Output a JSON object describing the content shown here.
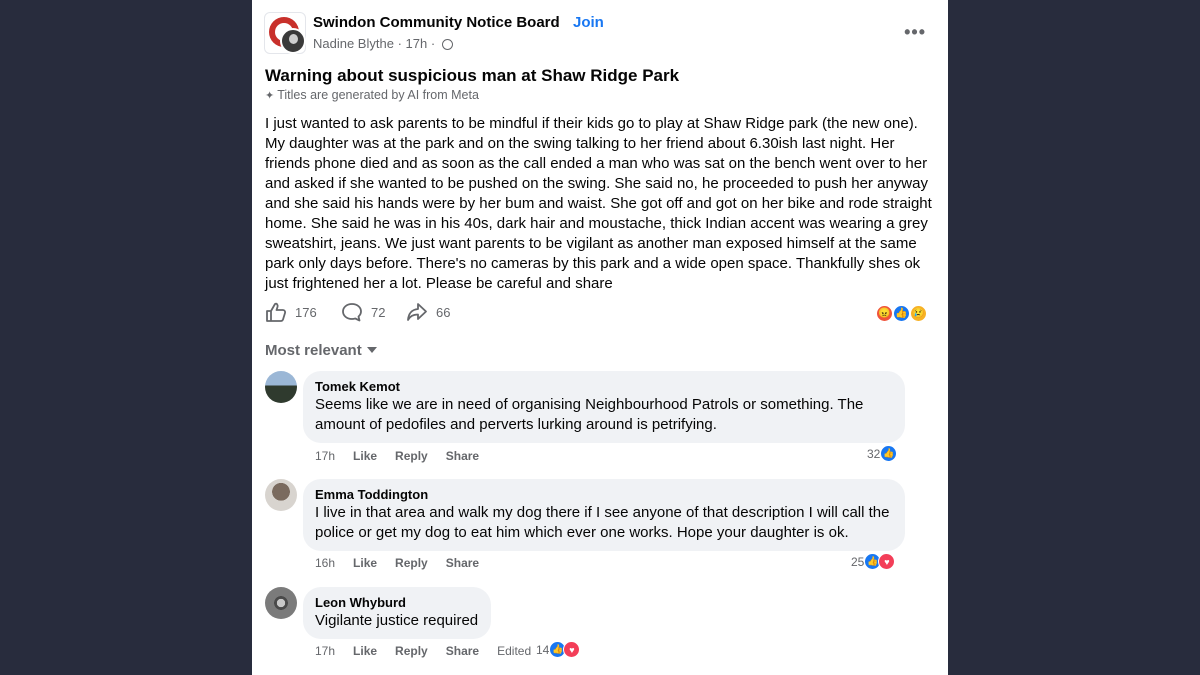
{
  "post": {
    "group_name": "Swindon Community Notice Board",
    "separator": "·",
    "join_label": "Join",
    "author": "Nadine Blythe",
    "time": "17h",
    "meta_sep": "·",
    "title": "Warning about suspicious man at Shaw Ridge Park",
    "ai_note": "Titles are generated by AI from Meta",
    "body": "I just wanted to ask parents to be mindful if their kids go to play at Shaw Ridge park (the new one). My daughter was at the park and on the swing talking to her friend about 6.30ish last night. Her friends phone died and as soon as the call ended a man who was sat on the bench went over to her and asked if she wanted to be pushed on the swing. She said no, he proceeded to push her anyway and she said his hands were by her bum and waist. She got off and got on her bike and rode straight home. She said he was in his 40s, dark hair and moustache, thick Indian accent was wearing a grey sweatshirt, jeans. We just want parents to be vigilant as another man exposed himself at the same park only days before. There's no cameras by this park and a wide open space. Thankfully shes ok just frightened her a lot. Please be careful and share",
    "likes": "176",
    "comments": "72",
    "shares": "66",
    "icons": [
      "angry-reaction-icon",
      "like-reaction-icon",
      "sad-reaction-icon"
    ]
  },
  "sort_label": "Most relevant",
  "comments": [
    {
      "name": "Tomek Kemot",
      "text": "Seems like we are in need of organising Neighbourhood Patrols or something. The amount of pedofiles and perverts lurking around is petrifying.",
      "time": "17h",
      "like": "Like",
      "reply": "Reply",
      "share": "Share",
      "reactions": "32"
    },
    {
      "name": "Emma Toddington",
      "text": "I live in that area and walk my dog there if I see anyone of that description I will call the police or get my dog to eat him which ever one works. Hope your daughter is ok.",
      "time": "16h",
      "like": "Like",
      "reply": "Reply",
      "share": "Share",
      "reactions": "25"
    },
    {
      "name": "Leon Whyburd",
      "text": "Vigilante justice required",
      "time": "17h",
      "like": "Like",
      "reply": "Reply",
      "share": "Share",
      "edited": "Edited",
      "reactions": "14"
    }
  ],
  "colors": {
    "accent": "#1877f2",
    "page_bg": "#282c3d",
    "bubble": "#f0f2f5",
    "secondary_text": "#65676b",
    "angry": "#f0533b",
    "love": "#f33e58",
    "sad": "#f7b125"
  }
}
